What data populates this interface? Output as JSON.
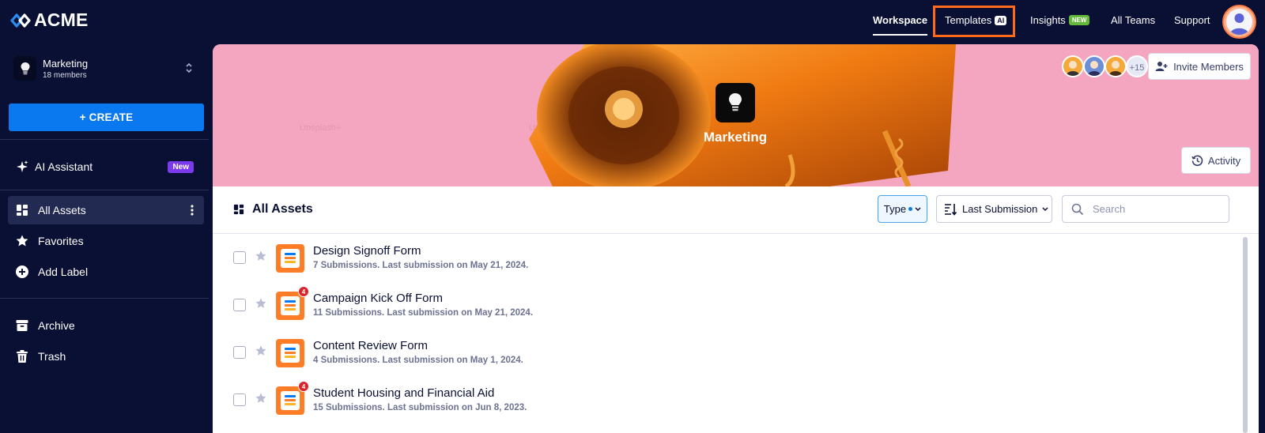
{
  "brand": {
    "name": "ACME",
    "logo_icon": "acme-logo-icon"
  },
  "nav": {
    "workspace": "Workspace",
    "templates": "Templates",
    "templates_badge": "AI",
    "insights": "Insights",
    "insights_badge": "NEW",
    "all_teams": "All Teams",
    "support": "Support"
  },
  "team": {
    "name": "Marketing",
    "members": "18 members"
  },
  "sidebar": {
    "create_label": "+ CREATE",
    "ai_assistant": "AI Assistant",
    "ai_badge": "New",
    "items": [
      {
        "label": "All Assets",
        "icon": "grid-icon"
      },
      {
        "label": "Favorites",
        "icon": "star-icon"
      },
      {
        "label": "Add Label",
        "icon": "plus-circle-icon"
      },
      {
        "label": "Archive",
        "icon": "archive-icon"
      },
      {
        "label": "Trash",
        "icon": "trash-icon"
      }
    ]
  },
  "banner": {
    "title": "Marketing",
    "extra_members": "+15",
    "invite_label": "Invite Members",
    "activity_label": "Activity",
    "watermark": "Unsplash+"
  },
  "toolbar": {
    "title": "All Assets",
    "type_label": "Type",
    "sort_label": "Last Submission",
    "search_placeholder": "Search"
  },
  "assets": [
    {
      "title": "Design Signoff Form",
      "meta": "7 Submissions. Last submission on May 21, 2024.",
      "notifications": ""
    },
    {
      "title": "Campaign Kick Off Form",
      "meta": "11 Submissions. Last submission on May 21, 2024.",
      "notifications": "4"
    },
    {
      "title": "Content Review Form",
      "meta": "4 Submissions. Last submission on May 1, 2024.",
      "notifications": ""
    },
    {
      "title": "Student Housing and Financial Aid",
      "meta": "15 Submissions. Last submission on Jun 8, 2023.",
      "notifications": "4"
    }
  ],
  "colors": {
    "background": "#0a1033",
    "accent": "#0a78ee",
    "highlight": "#ff6b1a",
    "form_icon": "#ff7d26",
    "ai_badge": "#7c3aed",
    "new_badge": "#64b83c"
  }
}
